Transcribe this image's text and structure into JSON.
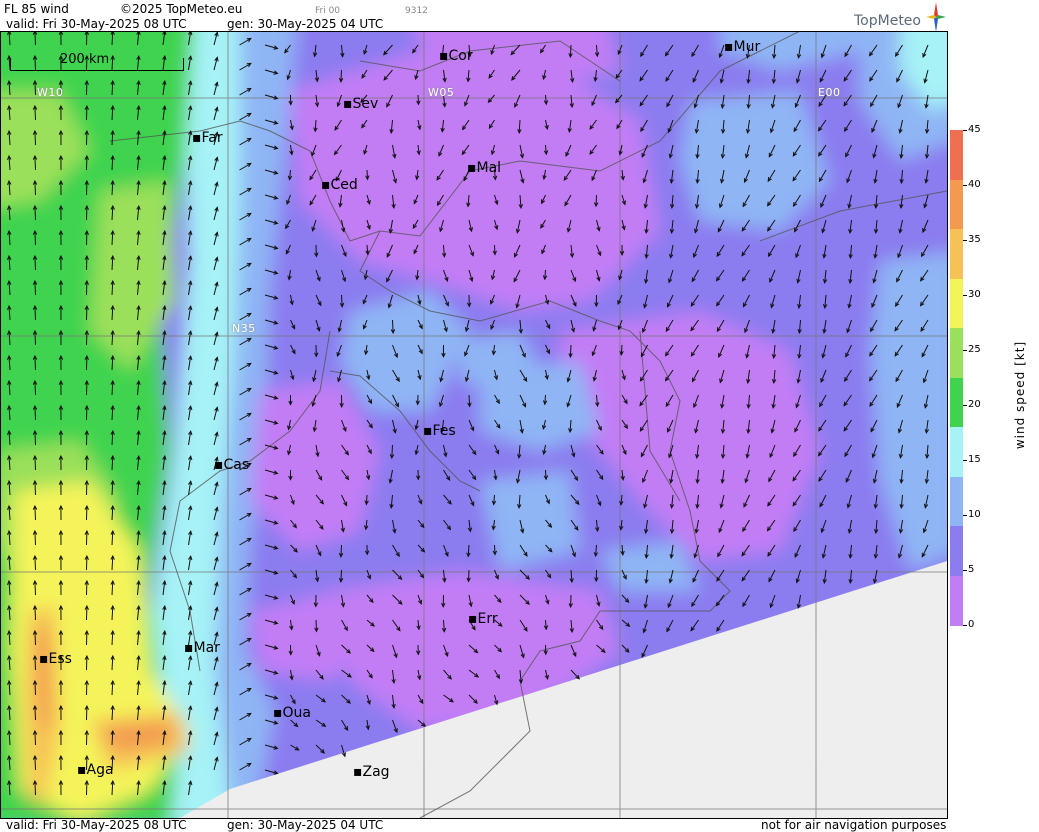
{
  "header": {
    "product": "FL 85 wind",
    "copyright": "©2025 TopMeteo.eu",
    "step": "Fri 00",
    "code": "9312",
    "valid": "valid:  Fri  30-May-2025  08 UTC",
    "generated": "gen: 30-May-2025 04 UTC",
    "logo_text": "TopMeteo"
  },
  "map": {
    "scale_label": "200 km",
    "grid_labels": {
      "w10": "W10",
      "w05": "W05",
      "e00": "E00",
      "n35": "N35"
    },
    "cities": [
      {
        "name": "Cor"
      },
      {
        "name": "Mur"
      },
      {
        "name": "Sev"
      },
      {
        "name": "Far"
      },
      {
        "name": "Mal"
      },
      {
        "name": "Ced"
      },
      {
        "name": "Fes"
      },
      {
        "name": "Cas"
      },
      {
        "name": "Mar"
      },
      {
        "name": "Ess"
      },
      {
        "name": "Err"
      },
      {
        "name": "Oua"
      },
      {
        "name": "Aga"
      },
      {
        "name": "Zag"
      }
    ],
    "no_data_color": "#eeeeee"
  },
  "colorbar": {
    "title": "wind speed [kt]",
    "ticks": [
      "0",
      "5",
      "10",
      "15",
      "20",
      "25",
      "30",
      "35",
      "40",
      "45"
    ],
    "colors": [
      "#c27df5",
      "#8b7cf0",
      "#8fb5f5",
      "#a6f2f6",
      "#3fd34f",
      "#9be05a",
      "#f4f45a",
      "#f6c256",
      "#f39a50",
      "#ee7050"
    ]
  },
  "footer": {
    "valid": "valid:  Fri  30-May-2025  08 UTC",
    "generated": "gen: 30-May-2025 04 UTC",
    "disclaimer": "not for air navigation purposes"
  }
}
